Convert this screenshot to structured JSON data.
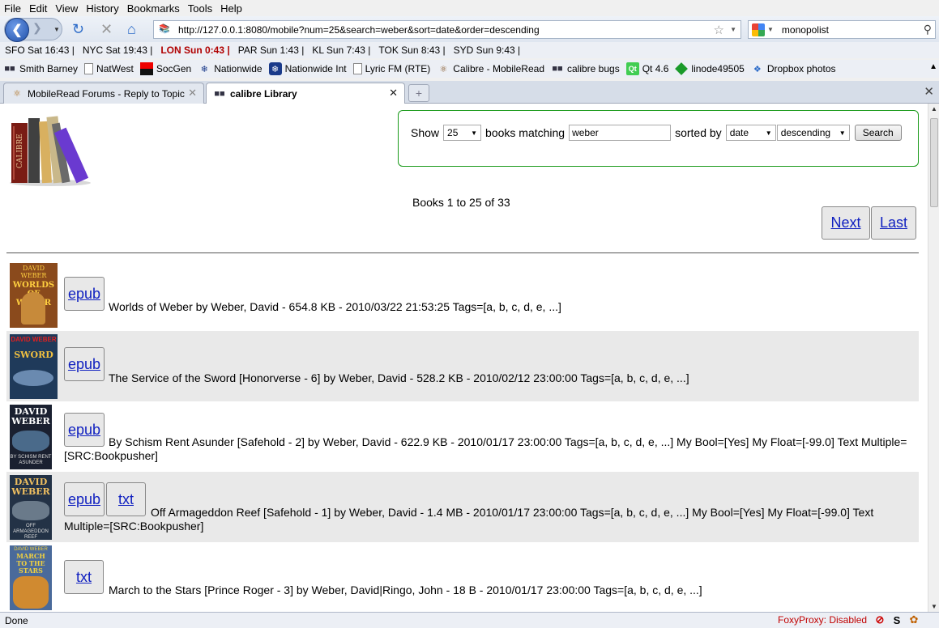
{
  "menu": [
    "File",
    "Edit",
    "View",
    "History",
    "Bookmarks",
    "Tools",
    "Help"
  ],
  "nav": {
    "url": "http://127.0.0.1:8080/mobile?num=25&search=weber&sort=date&order=descending",
    "search_value": "monopolist"
  },
  "clocks": [
    {
      "text": "SFO Sat 16:43 |",
      "highlight": false
    },
    {
      "text": "NYC Sat 19:43 |",
      "highlight": false
    },
    {
      "text": "LON Sun 0:43 |",
      "highlight": true
    },
    {
      "text": "PAR Sun 1:43 |",
      "highlight": false
    },
    {
      "text": "KL Sun 7:43 |",
      "highlight": false
    },
    {
      "text": "TOK Sun 8:43 |",
      "highlight": false
    },
    {
      "text": "SYD Sun 9:43 |",
      "highlight": false
    }
  ],
  "bookmarks": [
    {
      "label": "Smith Barney",
      "icon": "library-icon"
    },
    {
      "label": "NatWest",
      "icon": "page-icon"
    },
    {
      "label": "SocGen",
      "icon": "socgen-icon"
    },
    {
      "label": "Nationwide",
      "icon": "nationwide-icon"
    },
    {
      "label": "Nationwide Int",
      "icon": "nationwide-icon"
    },
    {
      "label": "Lyric FM (RTE)",
      "icon": "page-icon"
    },
    {
      "label": "Calibre - MobileRead",
      "icon": "calibre-icon"
    },
    {
      "label": "calibre bugs",
      "icon": "library-icon"
    },
    {
      "label": "Qt 4.6",
      "icon": "qt-icon"
    },
    {
      "label": "linode49505",
      "icon": "cube-icon"
    },
    {
      "label": "Dropbox photos",
      "icon": "dropbox-icon"
    }
  ],
  "tabs": [
    {
      "label": "MobileRead Forums - Reply to Topic"
    },
    {
      "label": "calibre Library"
    }
  ],
  "search_form": {
    "show_label": "Show",
    "num": "25",
    "matching_label": "books matching",
    "query": "weber",
    "sorted_label": "sorted by",
    "sort": "date",
    "order": "descending",
    "button": "Search"
  },
  "pagination": {
    "count_text": "Books 1 to 25 of 33",
    "next": "Next",
    "last": "Last"
  },
  "books": [
    {
      "formats": [
        "epub"
      ],
      "desc": "Worlds of Weber by Weber, David - 654.8 KB - 2010/03/22 21:53:25 Tags=[a, b, c, d, e, ...]",
      "cover": {
        "top_text": "DAVID WEBER",
        "title_text": "WORLDS OF WEBER",
        "bg": "#8a4a1c"
      }
    },
    {
      "formats": [
        "epub"
      ],
      "desc": "The Service of the Sword [Honorverse - 6] by Weber, David - 528.2 KB - 2010/02/12 23:00:00 Tags=[a, b, c, d, e, ...]",
      "cover": {
        "top_text": "DAVID WEBER",
        "title_text": "SWORD",
        "bg": "#1f3a5a"
      }
    },
    {
      "formats": [
        "epub"
      ],
      "desc": "By Schism Rent Asunder [Safehold - 2] by Weber, David - 622.9 KB - 2010/01/17 23:00:00 Tags=[a, b, c, d, e, ...] My Bool=[Yes] My Float=[-99.0] Text Multiple=[SRC:Bookpusher]",
      "cover": {
        "top_text": "DAVID WEBER",
        "title_text": "BY SCHISM RENT ASUNDER",
        "bg": "#1a2030"
      }
    },
    {
      "formats": [
        "epub",
        "txt"
      ],
      "desc": "Off Armageddon Reef [Safehold - 1] by Weber, David - 1.4 MB - 2010/01/17 23:00:00 Tags=[a, b, c, d, e, ...] My Bool=[Yes] My Float=[-99.0] Text Multiple=[SRC:Bookpusher]",
      "cover": {
        "top_text": "DAVID WEBER",
        "title_text": "OFF ARMAGEDDON REEF",
        "bg": "#233246"
      }
    },
    {
      "formats": [
        "txt"
      ],
      "desc": "March to the Stars [Prince Roger - 3] by Weber, David|Ringo, John - 18 B - 2010/01/17 23:00:00 Tags=[a, b, c, d, e, ...]",
      "cover": {
        "top_text": "DAVID WEBER",
        "title_text": "MARCH TO THE STARS",
        "bg": "#4a6a9a"
      }
    }
  ],
  "status": {
    "text": "Done",
    "foxy": "FoxyProxy: Disabled"
  },
  "colors": {
    "link": "#1020c0",
    "search_border": "#1a9a1a",
    "alt_row": "#e9e9e9",
    "clock_highlight": "#b00000"
  }
}
